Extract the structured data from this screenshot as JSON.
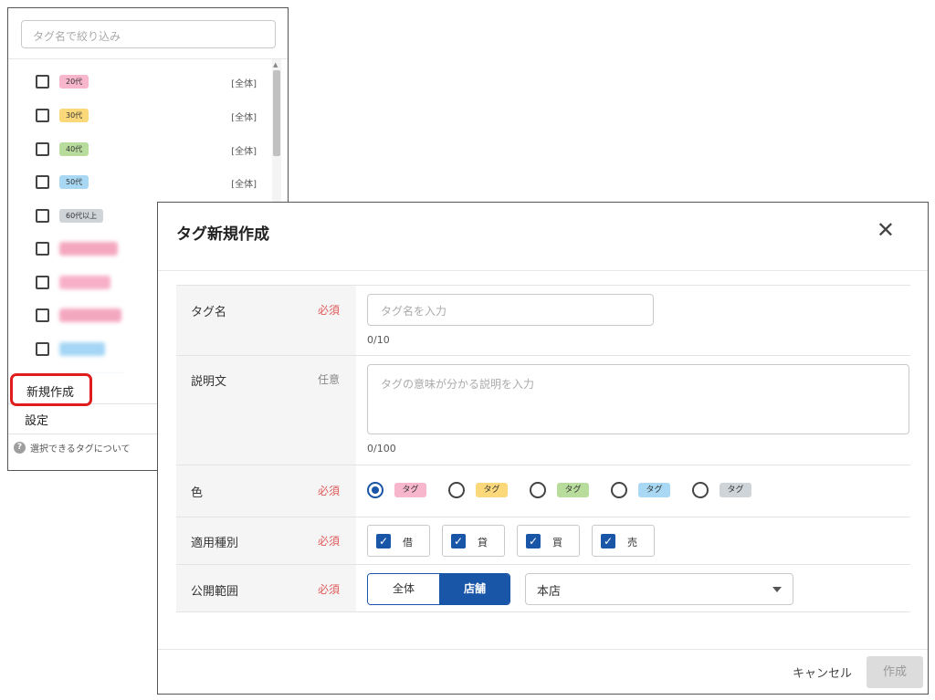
{
  "tag_panel": {
    "search_placeholder": "タグ名で絞り込み",
    "scope_label": "[全体]",
    "tags": [
      {
        "label": "20代",
        "color": "#f7b6cb"
      },
      {
        "label": "30代",
        "color": "#fbd97a"
      },
      {
        "label": "40代",
        "color": "#b8dc9c"
      },
      {
        "label": "50代",
        "color": "#a9d8f4"
      },
      {
        "label": "60代以上",
        "color": "#cfd4d8"
      }
    ],
    "blurred_tag_colors": [
      "#f4a8c0",
      "#f7b0c8",
      "#f4a8c0",
      "#a5d6f5",
      "#a5d6f5"
    ],
    "menu": {
      "new_label": "新規作成",
      "settings_label": "設定",
      "help_icon": "help-circle-icon",
      "help_text": "選択できるタグについて"
    }
  },
  "dialog": {
    "title": "タグ新規作成",
    "close_icon": "close-icon",
    "required_label": "必須",
    "optional_label": "任意",
    "fields": {
      "tag_name": {
        "label": "タグ名",
        "placeholder": "タグ名を入力",
        "count": "0/10"
      },
      "description": {
        "label": "説明文",
        "placeholder": "タグの意味が分かる説明を入力",
        "count": "0/100"
      },
      "color": {
        "label": "色",
        "chip_text": "タグ",
        "selected_index": 0,
        "options": [
          "#f7b6cb",
          "#fbd97a",
          "#b8dc9c",
          "#a9d8f4",
          "#cfd4d8"
        ]
      },
      "types": {
        "label": "適用種別",
        "options": [
          {
            "label": "借",
            "checked": true
          },
          {
            "label": "貸",
            "checked": true
          },
          {
            "label": "買",
            "checked": true
          },
          {
            "label": "売",
            "checked": true
          }
        ]
      },
      "scope": {
        "label": "公開範囲",
        "segment_all": "全体",
        "segment_store": "店舗",
        "selected": "店舗",
        "store_select_value": "本店"
      }
    },
    "footer": {
      "cancel_label": "キャンセル",
      "create_label": "作成"
    },
    "accent_color": "#1a56a8"
  }
}
